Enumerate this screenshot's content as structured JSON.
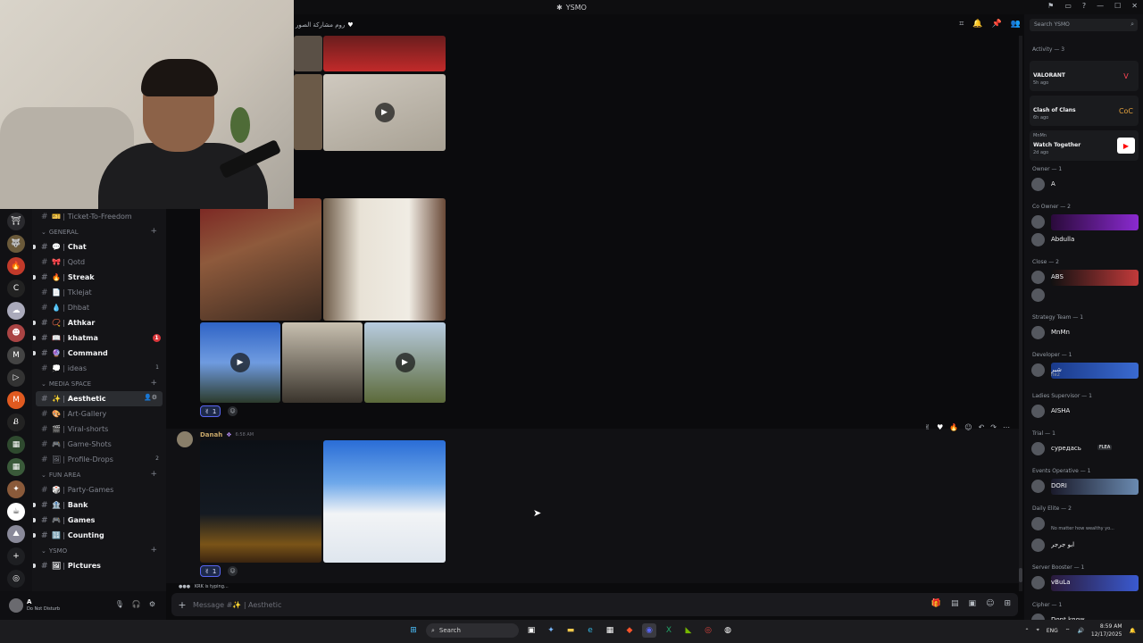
{
  "window": {
    "title": "YSMO",
    "header_snippet": "روم مشاركة الصور"
  },
  "sidebar": {
    "top_channel": {
      "emoji": "🎫",
      "label": "Ticket-To-Freedom"
    },
    "categories": [
      {
        "name": "GENERAL",
        "channels": [
          {
            "emoji": "💬",
            "label": "Chat",
            "bold": true
          },
          {
            "emoji": "🎀",
            "label": "Qotd",
            "bold": false
          },
          {
            "emoji": "🔥",
            "label": "Streak",
            "bold": true
          },
          {
            "emoji": "📄",
            "label": "Tklejat",
            "bold": false
          },
          {
            "emoji": "💧",
            "label": "Dhbat",
            "bold": false
          },
          {
            "emoji": "📿",
            "label": "Athkar",
            "bold": true
          },
          {
            "emoji": "📖",
            "label": "khatma",
            "bold": true,
            "badge": "1"
          },
          {
            "emoji": "🔮",
            "label": "Command",
            "bold": true
          },
          {
            "emoji": "💭",
            "label": "ideas",
            "bold": false,
            "count": "1"
          }
        ]
      },
      {
        "name": "MEDIA SPACE",
        "channels": [
          {
            "emoji": "✨",
            "label": "Aesthetic",
            "bold": true,
            "active": true
          },
          {
            "emoji": "🎨",
            "label": "Art-Gallery",
            "bold": false
          },
          {
            "emoji": "🎬",
            "label": "Viral-shorts",
            "bold": false
          },
          {
            "emoji": "🎮",
            "label": "Game-Shots",
            "bold": false
          },
          {
            "emoji": "🖼",
            "label": "Profile-Drops",
            "bold": false,
            "count": "2"
          }
        ]
      },
      {
        "name": "FUN AREA",
        "channels": [
          {
            "emoji": "🎲",
            "label": "Party-Games",
            "bold": false
          },
          {
            "emoji": "🏦",
            "label": "Bank",
            "bold": true
          },
          {
            "emoji": "🎮",
            "label": "Games",
            "bold": true
          },
          {
            "emoji": "🔢",
            "label": "Counting",
            "bold": true
          }
        ]
      },
      {
        "name": "YSMO",
        "channels": [
          {
            "emoji": "🖼",
            "label": "Pictures",
            "bold": true
          }
        ]
      }
    ]
  },
  "messages": {
    "reaction_count_1": "1",
    "reaction_count_2": "1",
    "author": "Danah",
    "time": "6:58 AM",
    "typing": "KRK is typing..."
  },
  "composer": {
    "placeholder": "Message #✨ | Aesthetic"
  },
  "user": {
    "name": "A",
    "status": "Do Not Disturb"
  },
  "right_panel": {
    "search_placeholder": "Search YSMO",
    "activity_title": "Activity — 3",
    "activities": [
      {
        "name": "VALORANT",
        "time": "5h ago",
        "icon": "V",
        "color": "#ff4655"
      },
      {
        "name": "Clash of Clans",
        "time": "6h ago",
        "icon": "CoC",
        "color": "#e6a23c"
      },
      {
        "name": "Watch Together",
        "time": "2d ago",
        "icon": "▶",
        "color": "#ff0000",
        "user": "MnMn"
      }
    ],
    "roles": [
      {
        "title": "Owner — 1",
        "members": [
          {
            "name": "A"
          }
        ]
      },
      {
        "title": "Co Owner — 2",
        "members": [
          {
            "name": ""
          },
          {
            "name": "Abdulla"
          }
        ]
      },
      {
        "title": "Close — 2",
        "members": [
          {
            "name": "ABS"
          },
          {
            "name": ""
          }
        ]
      },
      {
        "title": "Strategy Team — 1",
        "members": [
          {
            "name": "MnMn"
          }
        ]
      },
      {
        "title": "Developer — 1",
        "members": [
          {
            "name": "شير",
            "sub": "fte2"
          }
        ]
      },
      {
        "title": "Ladies Supervisor — 1",
        "members": [
          {
            "name": "AISHA"
          }
        ]
      },
      {
        "title": "Trial — 1",
        "members": [
          {
            "name": "суредась",
            "tag": "FLEA"
          }
        ]
      },
      {
        "title": "Events Operative — 1",
        "members": [
          {
            "name": "DORI"
          }
        ]
      },
      {
        "title": "Daily Elite — 2",
        "members": [
          {
            "name": "",
            "sub": "No matter how wealthy yo..."
          },
          {
            "name": "ابو جرجر"
          }
        ]
      },
      {
        "title": "Server Booster — 1",
        "members": [
          {
            "name": "vBuLa"
          }
        ]
      },
      {
        "title": "Cipher — 1",
        "members": [
          {
            "name": "Dont know"
          }
        ]
      }
    ]
  },
  "taskbar": {
    "search": "Search",
    "lang": "ENG",
    "time": "8:59 AM",
    "date": "12/17/2025"
  }
}
